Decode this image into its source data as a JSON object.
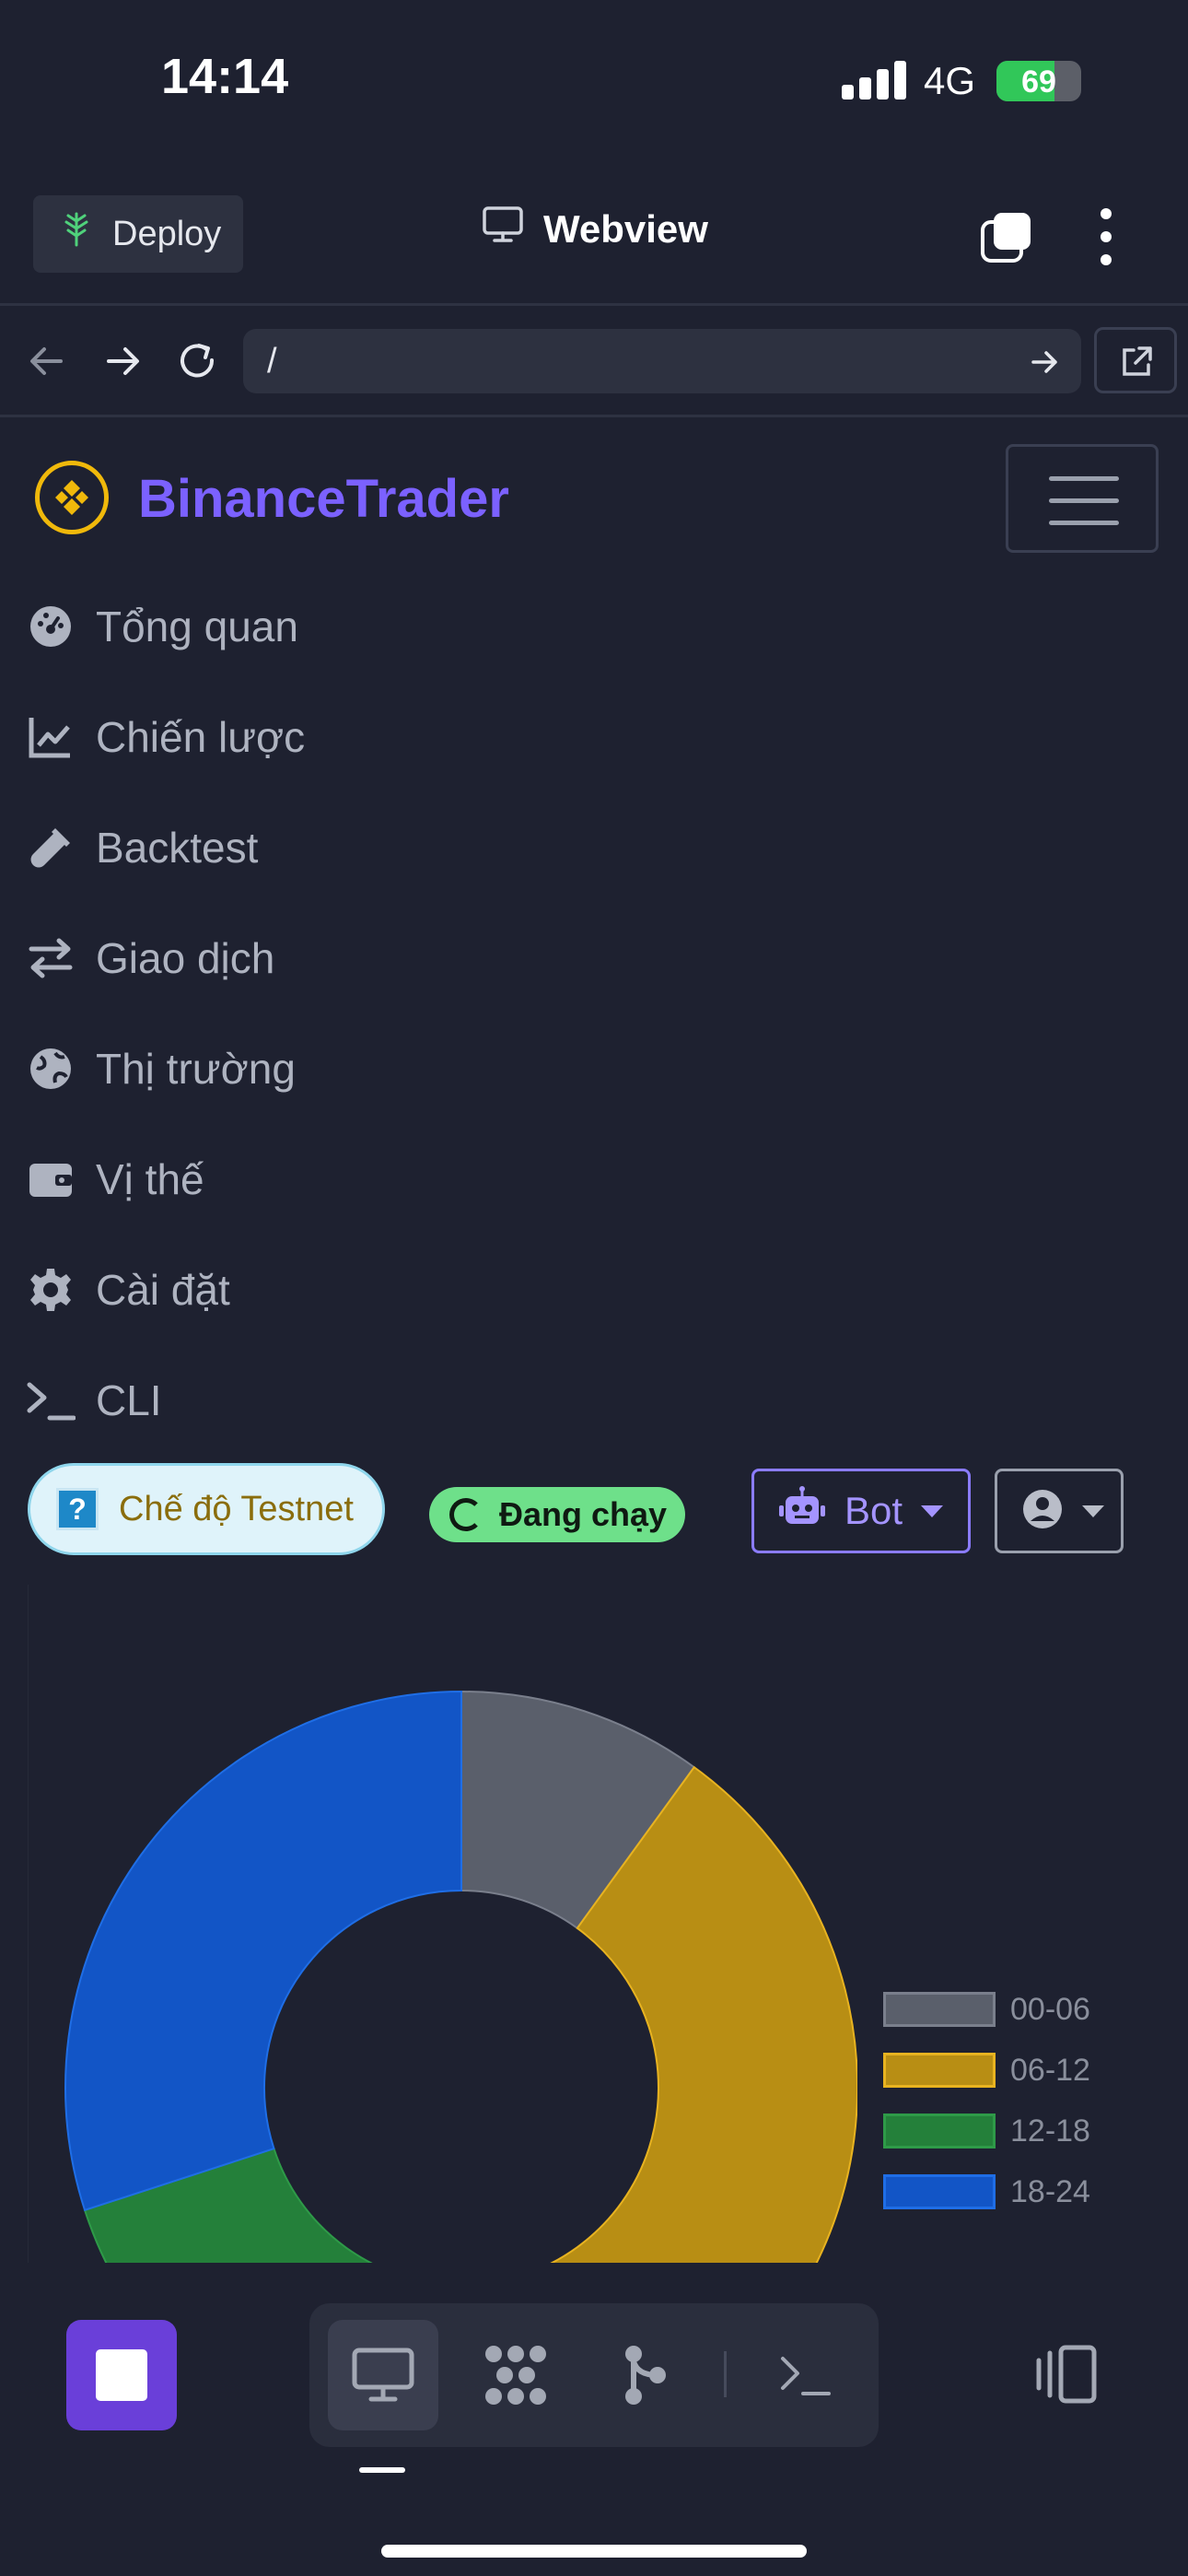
{
  "status": {
    "time": "14:14",
    "network": "4G",
    "battery": "69",
    "battery_level": 0.69
  },
  "toolbar": {
    "deploy_label": "Deploy",
    "title": "Webview"
  },
  "urlbar": {
    "value": "/"
  },
  "app": {
    "brand": "BinanceTrader"
  },
  "nav": {
    "items": [
      {
        "label": "Tổng quan",
        "icon": "gauge-icon"
      },
      {
        "label": "Chiến lược",
        "icon": "line-chart-icon"
      },
      {
        "label": "Backtest",
        "icon": "flask-icon"
      },
      {
        "label": "Giao dịch",
        "icon": "exchange-icon"
      },
      {
        "label": "Thị trường",
        "icon": "globe-icon"
      },
      {
        "label": "Vị thế",
        "icon": "wallet-icon"
      },
      {
        "label": "Cài đặt",
        "icon": "gear-icon"
      },
      {
        "label": "CLI",
        "icon": "terminal-icon"
      }
    ]
  },
  "controls": {
    "testnet_label": "Chế độ Testnet",
    "testnet_badge": "?",
    "running_label": "Đang chạy",
    "bot_label": "Bot"
  },
  "colors": {
    "accent": "#7b61ff",
    "brand": "#f0b90b",
    "running": "#6ee08a"
  },
  "chart_data": {
    "type": "pie",
    "variant": "doughnut",
    "categories": [
      "00-06",
      "06-12",
      "12-18",
      "18-24"
    ],
    "values": [
      10,
      40,
      20,
      30
    ],
    "colors": [
      "#5a5f6b",
      "#b88e14",
      "#24803a",
      "#1255c6"
    ],
    "legend": "right"
  }
}
